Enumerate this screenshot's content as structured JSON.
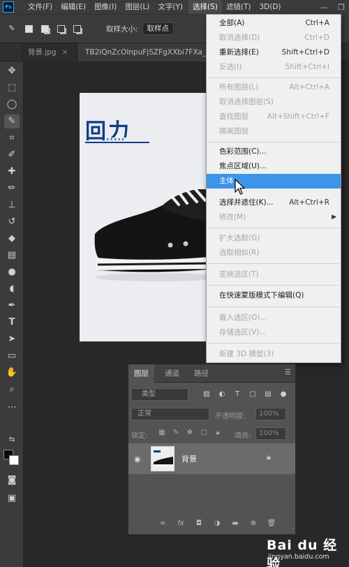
{
  "app": {
    "logo": "Ps"
  },
  "menubar": {
    "items": [
      "文件(F)",
      "编辑(E)",
      "图像(I)",
      "图层(L)",
      "文字(Y)",
      "选择(S)",
      "滤镜(T)",
      "3D(D)"
    ],
    "window_controls": [
      "—",
      "❐"
    ]
  },
  "options_bar": {
    "sample_label": "取样大小:",
    "sample_value": "取样点"
  },
  "tabs": [
    {
      "label": "背景.jpg",
      "close": "×"
    },
    {
      "label": "TB2iQnZcOlnpuFjSZFgXXbi7FXa_"
    }
  ],
  "canvas": {
    "logo_text": "回力",
    "logo_stars": "★★★★★"
  },
  "select_menu": {
    "items": [
      {
        "label": "全部(A)",
        "shortcut": "Ctrl+A",
        "disabled": false
      },
      {
        "label": "取消选择(D)",
        "shortcut": "Ctrl+D",
        "disabled": true
      },
      {
        "label": "重新选择(E)",
        "shortcut": "Shift+Ctrl+D",
        "disabled": false
      },
      {
        "label": "反选(I)",
        "shortcut": "Shift+Ctrl+I",
        "disabled": true
      },
      {
        "label": "所有图层(L)",
        "shortcut": "Alt+Ctrl+A",
        "disabled": true
      },
      {
        "label": "取消选择图层(S)",
        "shortcut": "",
        "disabled": true
      },
      {
        "label": "查找图层",
        "shortcut": "Alt+Shift+Ctrl+F",
        "disabled": true
      },
      {
        "label": "隔离图层",
        "shortcut": "",
        "disabled": true
      },
      {
        "label": "色彩范围(C)...",
        "shortcut": "",
        "disabled": false
      },
      {
        "label": "焦点区域(U)...",
        "shortcut": "",
        "disabled": false
      },
      {
        "label": "主体",
        "shortcut": "",
        "disabled": false,
        "highlighted": true
      },
      {
        "label": "选择并遮住(K)...",
        "shortcut": "Alt+Ctrl+R",
        "disabled": false
      },
      {
        "label": "修改(M)",
        "shortcut": "",
        "disabled": true,
        "submenu": "▶"
      },
      {
        "label": "扩大选取(G)",
        "shortcut": "",
        "disabled": true
      },
      {
        "label": "选取相似(R)",
        "shortcut": "",
        "disabled": true
      },
      {
        "label": "变换选区(T)",
        "shortcut": "",
        "disabled": true
      },
      {
        "label": "在快速蒙版模式下编辑(Q)",
        "shortcut": "",
        "disabled": false
      },
      {
        "label": "载入选区(O)...",
        "shortcut": "",
        "disabled": true
      },
      {
        "label": "存储选区(V)...",
        "shortcut": "",
        "disabled": true
      },
      {
        "label": "新建 3D 模型(3)",
        "shortcut": "",
        "disabled": true
      }
    ]
  },
  "layers_panel": {
    "tabs": [
      "图层",
      "通道",
      "路径"
    ],
    "filter_label": "类型",
    "blend_mode": "正常",
    "opacity_label": "不透明度:",
    "opacity_value": "100%",
    "lock_label": "锁定:",
    "fill_label": "填充:",
    "fill_value": "100%",
    "layer": {
      "name": "背景"
    }
  },
  "watermark": {
    "brand": "Bai du 经验",
    "url": "jingyan.baidu.com"
  },
  "colors": {
    "accent_highlight": "#3c95e8",
    "logo_blue": "#0f3d86",
    "foreground": "#0a0a0a",
    "background": "#ffffff"
  }
}
